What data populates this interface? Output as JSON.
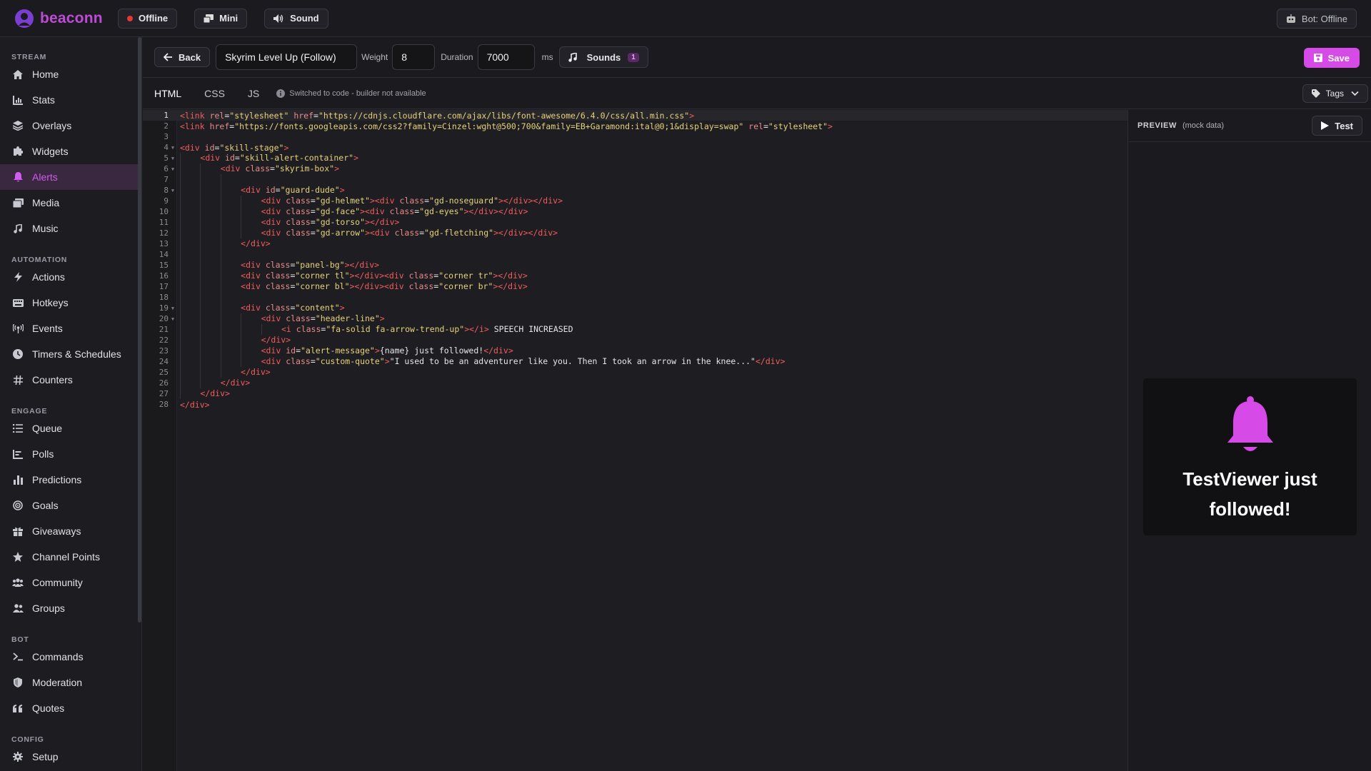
{
  "brand": {
    "name": "beaconn",
    "accent": "#d64ae8"
  },
  "topbar": {
    "status_label": "Offline",
    "mini_label": "Mini",
    "sound_label": "Sound",
    "bot_status": "Bot: Offline"
  },
  "sidebar": {
    "sections": [
      {
        "title": "STREAM",
        "items": [
          {
            "label": "Home",
            "icon": "home-icon"
          },
          {
            "label": "Stats",
            "icon": "stats-icon"
          },
          {
            "label": "Overlays",
            "icon": "layers-icon"
          },
          {
            "label": "Widgets",
            "icon": "puzzle-icon"
          },
          {
            "label": "Alerts",
            "icon": "bell-icon",
            "active": true
          },
          {
            "label": "Media",
            "icon": "media-icon"
          },
          {
            "label": "Music",
            "icon": "music-icon"
          }
        ]
      },
      {
        "title": "AUTOMATION",
        "items": [
          {
            "label": "Actions",
            "icon": "bolt-icon"
          },
          {
            "label": "Hotkeys",
            "icon": "keyboard-icon"
          },
          {
            "label": "Events",
            "icon": "broadcast-icon"
          },
          {
            "label": "Timers & Schedules",
            "icon": "clock-icon"
          },
          {
            "label": "Counters",
            "icon": "hash-icon"
          }
        ]
      },
      {
        "title": "ENGAGE",
        "items": [
          {
            "label": "Queue",
            "icon": "list-icon"
          },
          {
            "label": "Polls",
            "icon": "poll-icon"
          },
          {
            "label": "Predictions",
            "icon": "bar-chart-icon"
          },
          {
            "label": "Goals",
            "icon": "target-icon"
          },
          {
            "label": "Giveaways",
            "icon": "gift-icon"
          },
          {
            "label": "Channel Points",
            "icon": "star-icon"
          },
          {
            "label": "Community",
            "icon": "community-icon"
          },
          {
            "label": "Groups",
            "icon": "group-icon"
          }
        ]
      },
      {
        "title": "BOT",
        "items": [
          {
            "label": "Commands",
            "icon": "terminal-icon"
          },
          {
            "label": "Moderation",
            "icon": "shield-icon"
          },
          {
            "label": "Quotes",
            "icon": "quote-icon"
          }
        ]
      },
      {
        "title": "CONFIG",
        "items": [
          {
            "label": "Setup",
            "icon": "gear-icon"
          }
        ]
      }
    ]
  },
  "toolbar": {
    "back_label": "Back",
    "alert_name": "Skyrim Level Up (Follow)",
    "weight_label": "Weight",
    "weight_value": "8",
    "duration_label": "Duration",
    "duration_value": "7000",
    "duration_unit": "ms",
    "sounds_label": "Sounds",
    "sounds_count": "1",
    "save_label": "Save"
  },
  "tabs": {
    "items": [
      {
        "label": "HTML",
        "active": true
      },
      {
        "label": "CSS"
      },
      {
        "label": "JS"
      }
    ],
    "info_text": "Switched to code - builder not available",
    "tags_label": "Tags"
  },
  "editor": {
    "current_line": 1,
    "lines": [
      {
        "indent": 0,
        "html": "<span class='t'>&lt;link</span> <span class='a'>rel</span><span class='p'>=</span><span class='s'>\"stylesheet\"</span> <span class='a'>href</span><span class='p'>=</span><span class='s'>\"https://cdnjs.cloudflare.com/ajax/libs/font-awesome/6.4.0/css/all.min.css\"</span><span class='t'>&gt;</span>"
      },
      {
        "indent": 0,
        "html": "<span class='t'>&lt;link</span> <span class='a'>href</span><span class='p'>=</span><span class='s'>\"https://fonts.googleapis.com/css2?family=Cinzel:wght@500;700&amp;family=EB+Garamond:ital@0;1&amp;display=swap\"</span> <span class='a'>rel</span><span class='p'>=</span><span class='s'>\"stylesheet\"</span><span class='t'>&gt;</span>"
      },
      {
        "indent": 0,
        "html": ""
      },
      {
        "indent": 0,
        "fold": true,
        "html": "<span class='t'>&lt;div</span> <span class='a'>id</span><span class='p'>=</span><span class='s'>\"skill-stage\"</span><span class='t'>&gt;</span>"
      },
      {
        "indent": 1,
        "fold": true,
        "html": "<span class='t'>&lt;div</span> <span class='a'>id</span><span class='p'>=</span><span class='s'>\"skill-alert-container\"</span><span class='t'>&gt;</span>"
      },
      {
        "indent": 2,
        "fold": true,
        "html": "<span class='t'>&lt;div</span> <span class='a'>class</span><span class='p'>=</span><span class='s'>\"skyrim-box\"</span><span class='t'>&gt;</span>"
      },
      {
        "indent": 3,
        "html": ""
      },
      {
        "indent": 3,
        "fold": true,
        "html": "<span class='t'>&lt;div</span> <span class='a'>id</span><span class='p'>=</span><span class='s'>\"guard-dude\"</span><span class='t'>&gt;</span>"
      },
      {
        "indent": 4,
        "html": "<span class='t'>&lt;div</span> <span class='a'>class</span><span class='p'>=</span><span class='s'>\"gd-helmet\"</span><span class='t'>&gt;&lt;div</span> <span class='a'>class</span><span class='p'>=</span><span class='s'>\"gd-noseguard\"</span><span class='t'>&gt;&lt;/div&gt;&lt;/div&gt;</span>"
      },
      {
        "indent": 4,
        "html": "<span class='t'>&lt;div</span> <span class='a'>class</span><span class='p'>=</span><span class='s'>\"gd-face\"</span><span class='t'>&gt;&lt;div</span> <span class='a'>class</span><span class='p'>=</span><span class='s'>\"gd-eyes\"</span><span class='t'>&gt;&lt;/div&gt;&lt;/div&gt;</span>"
      },
      {
        "indent": 4,
        "html": "<span class='t'>&lt;div</span> <span class='a'>class</span><span class='p'>=</span><span class='s'>\"gd-torso\"</span><span class='t'>&gt;&lt;/div&gt;</span>"
      },
      {
        "indent": 4,
        "html": "<span class='t'>&lt;div</span> <span class='a'>class</span><span class='p'>=</span><span class='s'>\"gd-arrow\"</span><span class='t'>&gt;&lt;div</span> <span class='a'>class</span><span class='p'>=</span><span class='s'>\"gd-fletching\"</span><span class='t'>&gt;&lt;/div&gt;&lt;/div&gt;</span>"
      },
      {
        "indent": 3,
        "html": "<span class='t'>&lt;/div&gt;</span>"
      },
      {
        "indent": 3,
        "html": ""
      },
      {
        "indent": 3,
        "html": "<span class='t'>&lt;div</span> <span class='a'>class</span><span class='p'>=</span><span class='s'>\"panel-bg\"</span><span class='t'>&gt;&lt;/div&gt;</span>"
      },
      {
        "indent": 3,
        "html": "<span class='t'>&lt;div</span> <span class='a'>class</span><span class='p'>=</span><span class='s'>\"corner tl\"</span><span class='t'>&gt;&lt;/div&gt;&lt;div</span> <span class='a'>class</span><span class='p'>=</span><span class='s'>\"corner tr\"</span><span class='t'>&gt;&lt;/div&gt;</span>"
      },
      {
        "indent": 3,
        "html": "<span class='t'>&lt;div</span> <span class='a'>class</span><span class='p'>=</span><span class='s'>\"corner bl\"</span><span class='t'>&gt;&lt;/div&gt;&lt;div</span> <span class='a'>class</span><span class='p'>=</span><span class='s'>\"corner br\"</span><span class='t'>&gt;&lt;/div&gt;</span>"
      },
      {
        "indent": 3,
        "html": ""
      },
      {
        "indent": 3,
        "fold": true,
        "html": "<span class='t'>&lt;div</span> <span class='a'>class</span><span class='p'>=</span><span class='s'>\"content\"</span><span class='t'>&gt;</span>"
      },
      {
        "indent": 4,
        "fold": true,
        "html": "<span class='t'>&lt;div</span> <span class='a'>class</span><span class='p'>=</span><span class='s'>\"header-line\"</span><span class='t'>&gt;</span>"
      },
      {
        "indent": 5,
        "html": "<span class='t'>&lt;i</span> <span class='a'>class</span><span class='p'>=</span><span class='s'>\"fa-solid fa-arrow-trend-up\"</span><span class='t'>&gt;&lt;/i&gt;</span><span class='p'> SPEECH INCREASED</span>"
      },
      {
        "indent": 4,
        "html": "<span class='t'>&lt;/div&gt;</span>"
      },
      {
        "indent": 4,
        "html": "<span class='t'>&lt;div</span> <span class='a'>id</span><span class='p'>=</span><span class='s'>\"alert-message\"</span><span class='t'>&gt;</span><span class='p'>{name} just followed!</span><span class='t'>&lt;/div&gt;</span>"
      },
      {
        "indent": 4,
        "html": "<span class='t'>&lt;div</span> <span class='a'>class</span><span class='p'>=</span><span class='s'>\"custom-quote\"</span><span class='t'>&gt;</span><span class='p'>\"I used to be an adventurer like you. Then I took an arrow in the knee...\"</span><span class='t'>&lt;/div&gt;</span>"
      },
      {
        "indent": 3,
        "html": "<span class='t'>&lt;/div&gt;</span>"
      },
      {
        "indent": 2,
        "html": "<span class='t'>&lt;/div&gt;</span>"
      },
      {
        "indent": 1,
        "html": "<span class='t'>&lt;/div&gt;</span>"
      },
      {
        "indent": 0,
        "html": "<span class='t'>&lt;/div&gt;</span>"
      }
    ]
  },
  "preview": {
    "title": "PREVIEW",
    "subtitle": "(mock data)",
    "test_label": "Test",
    "alert_text": "TestViewer just followed!",
    "bell_color": "#d64ae8"
  }
}
